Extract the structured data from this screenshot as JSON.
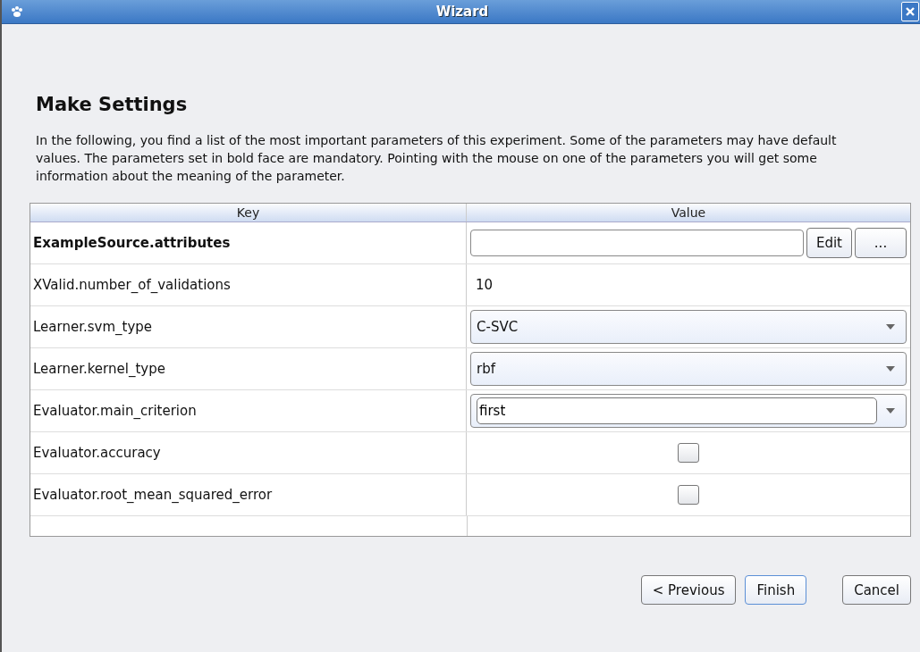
{
  "window": {
    "title": "Wizard"
  },
  "heading": "Make Settings",
  "description": "In the following, you find a list of the most important parameters of this experiment. Some of the parameters may have default values. The parameters set in bold face are mandatory. Pointing with the mouse on one of the parameters you will get some information about the meaning of the parameter.",
  "table": {
    "columns": [
      "Key",
      "Value"
    ],
    "rows": [
      {
        "key": "ExampleSource.attributes",
        "mandatory": true,
        "kind": "file",
        "value": "",
        "buttons": [
          "Edit",
          "..."
        ]
      },
      {
        "key": "XValid.number_of_validations",
        "mandatory": false,
        "kind": "text",
        "value": "10"
      },
      {
        "key": "Learner.svm_type",
        "mandatory": false,
        "kind": "select",
        "value": "C-SVC"
      },
      {
        "key": "Learner.kernel_type",
        "mandatory": false,
        "kind": "select",
        "value": "rbf"
      },
      {
        "key": "Evaluator.main_criterion",
        "mandatory": false,
        "kind": "combo",
        "value": "first"
      },
      {
        "key": "Evaluator.accuracy",
        "mandatory": false,
        "kind": "checkbox",
        "checked": false
      },
      {
        "key": "Evaluator.root_mean_squared_error",
        "mandatory": false,
        "kind": "checkbox",
        "checked": false
      }
    ]
  },
  "buttons": [
    {
      "label": "< Previous",
      "focused": false
    },
    {
      "label": "Finish",
      "focused": true
    },
    {
      "label": "Cancel",
      "focused": false
    }
  ]
}
